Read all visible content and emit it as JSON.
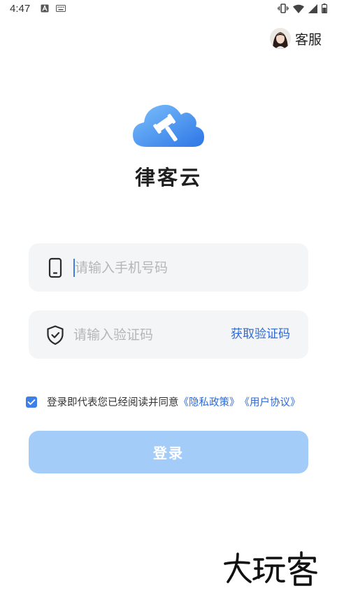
{
  "status_bar": {
    "time": "4:47",
    "icons": [
      "a-badge-icon",
      "keyboard-icon",
      "vibrate-icon",
      "wifi-icon",
      "signal-icon",
      "battery-icon"
    ]
  },
  "header": {
    "service_label": "客服"
  },
  "app": {
    "name": "律客云"
  },
  "form": {
    "phone_placeholder": "请输入手机号码",
    "code_placeholder": "请输入验证码",
    "get_code_label": "获取验证码"
  },
  "agreement": {
    "checked": true,
    "text": "登录即代表您已经阅读并同意",
    "privacy_link": "《隐私政策》",
    "user_link": "《用户协议》"
  },
  "login_button": {
    "label": "登录"
  },
  "watermark": {
    "text": "大玩客"
  },
  "colors": {
    "accent": "#2f6ad4",
    "button_disabled": "#a3cdf8",
    "field_bg": "#f4f5f7",
    "checkbox": "#3d80e8"
  }
}
